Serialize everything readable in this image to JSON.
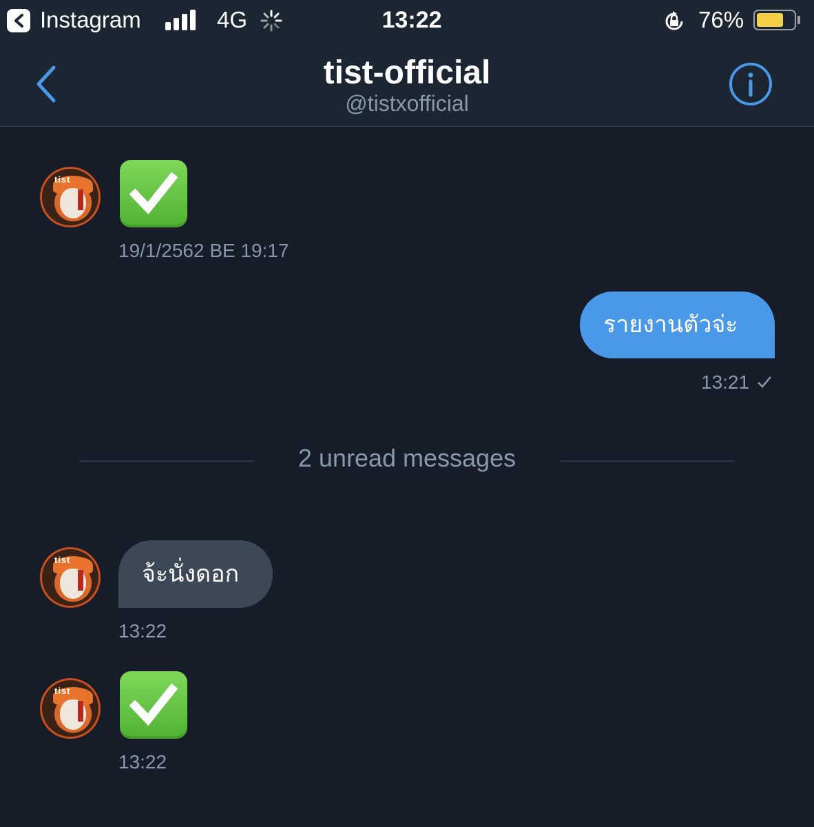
{
  "status_bar": {
    "back_app": "Instagram",
    "network": "4G",
    "time": "13:22",
    "battery_percent": "76%",
    "battery_level": 0.76
  },
  "header": {
    "title": "tist-official",
    "handle": "@tistxofficial"
  },
  "messages": [
    {
      "direction": "incoming",
      "content_type": "emoji",
      "emoji": "white-heavy-check-mark",
      "timestamp": "19/1/2562 BE 19:17"
    },
    {
      "direction": "outgoing",
      "content_type": "text",
      "text": "รายงานตัวจ่ะ",
      "timestamp": "13:21"
    },
    {
      "direction": "incoming",
      "content_type": "text",
      "text": "จ้ะนั่งดอก",
      "timestamp": "13:22"
    },
    {
      "direction": "incoming",
      "content_type": "emoji",
      "emoji": "white-heavy-check-mark",
      "timestamp": "13:22"
    }
  ],
  "unread_divider": "2 unread messages",
  "colors": {
    "background": "#161d28",
    "header": "#1c2532",
    "outgoing_bubble": "#4a99e9",
    "incoming_bubble": "#3d4857",
    "accent": "#4a99e9",
    "muted_text": "#8899a6"
  }
}
